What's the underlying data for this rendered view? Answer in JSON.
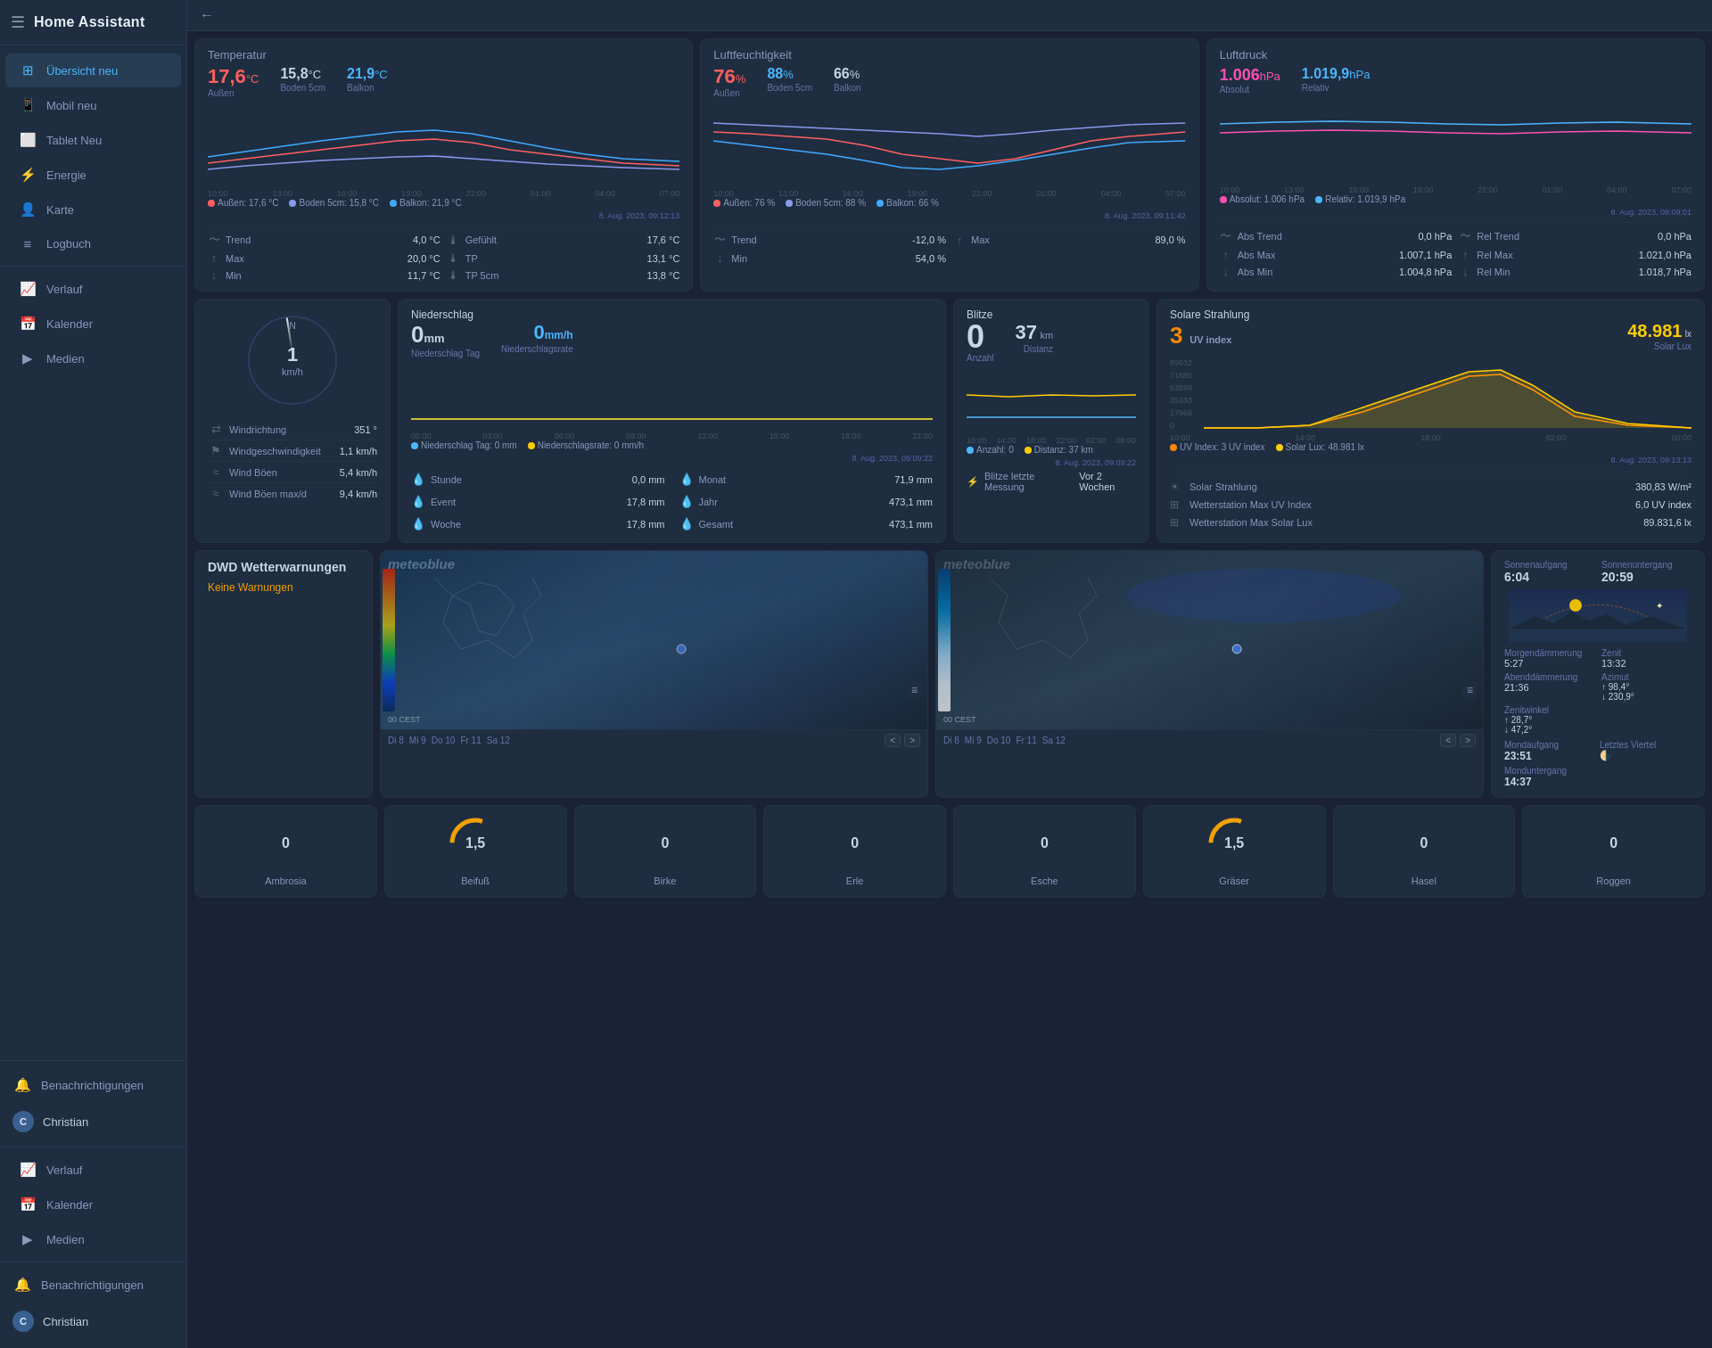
{
  "app": {
    "title": "Home Assistant",
    "back_label": "←"
  },
  "sidebar": {
    "items": [
      {
        "id": "ubersicht",
        "label": "Übersicht neu",
        "icon": "⊞",
        "active": true
      },
      {
        "id": "mobil",
        "label": "Mobil neu",
        "icon": "📱",
        "active": false
      },
      {
        "id": "tablet",
        "label": "Tablet Neu",
        "icon": "⬜",
        "active": false
      },
      {
        "id": "energie",
        "label": "Energie",
        "icon": "⚡",
        "active": false
      },
      {
        "id": "karte",
        "label": "Karte",
        "icon": "👤",
        "active": false
      },
      {
        "id": "logbuch",
        "label": "Logbuch",
        "icon": "≡",
        "active": false
      },
      {
        "id": "verlauf",
        "label": "Verlauf",
        "icon": "📈",
        "active": false
      },
      {
        "id": "kalender",
        "label": "Kalender",
        "icon": "📅",
        "active": false
      },
      {
        "id": "medien",
        "label": "Medien",
        "icon": "▶",
        "active": false
      }
    ],
    "bottom_items": [
      {
        "id": "benachrichtigungen",
        "label": "Benachrichtigungen",
        "icon": "🔔"
      },
      {
        "id": "verlauf2",
        "label": "Verlauf",
        "icon": "📈"
      },
      {
        "id": "kalender2",
        "label": "Kalender",
        "icon": "📅"
      },
      {
        "id": "medien2",
        "label": "Medien",
        "icon": "▶"
      }
    ],
    "user": {
      "name": "Christian",
      "initial": "C"
    },
    "notifications_label": "Benachrichtigungen"
  },
  "temp": {
    "title": "Temperatur",
    "aussen_val": "17,6",
    "aussen_unit": "°C",
    "aussen_label": "Außen",
    "boden_val": "15,8",
    "boden_unit": "°C",
    "boden_label": "Boden 5cm",
    "balkon_val": "21,9",
    "balkon_unit": "°C",
    "balkon_label": "Balkon",
    "timestamp": "8. Aug. 2023, 09:12:13",
    "legend_aussen": "Außen: 17,6 °C",
    "legend_boden": "Boden 5cm: 15,8 °C",
    "legend_balkon": "Balkon: 21,9 °C",
    "trend_label": "Trend",
    "trend_val": "4,0 °C",
    "max_label": "Max",
    "max_val": "20,0 °C",
    "min_label": "Min",
    "min_val": "11,7 °C",
    "gefuhlt_label": "Gefühlt",
    "gefuhlt_val": "17,6 °C",
    "tp_label": "TP",
    "tp_val": "13,1 °C",
    "tp5_label": "TP 5cm",
    "tp5_val": "13,8 °C"
  },
  "humidity": {
    "title": "Luftfeuchtigkeit",
    "aussen_val": "76",
    "aussen_unit": "%",
    "aussen_label": "Außen",
    "boden_val": "88",
    "boden_unit": "%",
    "boden_label": "Boden 5cm",
    "balkon_val": "66",
    "balkon_unit": "%",
    "balkon_label": "Balkon",
    "timestamp": "8. Aug. 2023, 09:11:42",
    "legend_aussen": "Außen: 76 %",
    "legend_boden": "Boden 5cm: 88 %",
    "legend_balkon": "Balkon: 66 %",
    "trend_label": "Trend",
    "trend_val": "-12,0 %",
    "max_label": "Max",
    "max_val": "89,0 %",
    "min_label": "Min",
    "min_val": "54,0 %"
  },
  "pressure": {
    "title": "Luftdruck",
    "abs_val": "1.006",
    "abs_unit": "hPa",
    "abs_label": "Absolut",
    "rel_val": "1.019,9",
    "rel_unit": "hPa",
    "rel_label": "Relativ",
    "timestamp": "8. Aug. 2023, 09:09:01",
    "legend_abs": "Absolut: 1.006 hPa",
    "legend_rel": "Relativ: 1.019,9 hPa",
    "abs_trend_label": "Abs Trend",
    "abs_trend_val": "0,0 hPa",
    "rel_trend_label": "Rel Trend",
    "rel_trend_val": "0,0 hPa",
    "abs_max_label": "Abs Max",
    "abs_max_val": "1.007,1 hPa",
    "rel_max_label": "Rel Max",
    "rel_max_val": "1.021,0 hPa",
    "abs_min_label": "Abs Min",
    "abs_min_val": "1.004,8 hPa",
    "rel_min_label": "Rel Min",
    "rel_min_val": "1.018,7 hPa"
  },
  "wind": {
    "speed": "1",
    "speed_unit": "km/h",
    "direction_label": "Windrichtung",
    "direction_val": "351 °",
    "speed_label": "Windgeschwindigkeit",
    "speed_val": "1,1 km/h",
    "boen_label": "Wind Böen",
    "boen_val": "5,4 km/h",
    "boen_max_label": "Wind Böen max/d",
    "boen_max_val": "9,4 km/h",
    "n_label": "N"
  },
  "niederschlag": {
    "title": "Niederschlag",
    "main_val": "0",
    "main_unit": "mm",
    "main_label": "Niederschlag Tag",
    "rate_val": "0",
    "rate_unit": "mm/h",
    "rate_label": "Niederschlagsrate",
    "timestamp": "8. Aug. 2023, 09:09:22",
    "legend_tag": "Niederschlag Tag: 0 mm",
    "legend_rate": "Niederschlagsrate: 0 mm/h",
    "stunde_label": "Stunde",
    "stunde_val": "0,0 mm",
    "monat_label": "Monat",
    "monat_val": "71,9 mm",
    "event_label": "Event",
    "event_val": "17,8 mm",
    "jahr_label": "Jahr",
    "jahr_val": "473,1 mm",
    "woche_label": "Woche",
    "woche_val": "17,8 mm",
    "gesamt_label": "Gesamt",
    "gesamt_val": "473,1 mm"
  },
  "blitze": {
    "title": "Blitze",
    "count_val": "0",
    "count_label": "Anzahl",
    "dist_val": "37",
    "dist_unit": "km",
    "dist_label": "Distanz",
    "last_label": "Blitze letzte Messung",
    "last_val": "Vor 2 Wochen",
    "timestamp": "8. Aug. 2023, 09:09:22",
    "legend_anzahl": "Anzahl: 0",
    "legend_distanz": "Distanz: 37 km"
  },
  "solar": {
    "title": "Solare Strahlung",
    "uv_index_val": "3",
    "uv_index_label": "UV index",
    "lux_val": "48.981",
    "lux_unit": "lx",
    "lux_label": "Solar Lux",
    "timestamp": "8. Aug. 2023, 09:13:13",
    "legend_uv": "UV Index: 3 UV index",
    "legend_lux": "Solar Lux: 48.981 lx",
    "solar_label": "Solar Strahlung",
    "solar_val": "380,83 W/m²",
    "uv_max_label": "Wetterstation Max UV Index",
    "uv_max_val": "6,0 UV index",
    "lux_max_label": "Wetterstation Max Solar Lux",
    "lux_max_val": "89.831,6 lx",
    "y_labels": [
      "89832",
      "71885",
      "53899",
      "35933",
      "17966",
      "0"
    ]
  },
  "wetter": {
    "title": "DWD Wetterwarnungen",
    "status": "Keine Warnungen"
  },
  "sun": {
    "sunrise_label": "Sonnenaufgang",
    "sunrise_val": "6:04",
    "sunset_label": "Sonnenuntergang",
    "sunset_val": "20:59",
    "dawn_label": "Morgendämmerung",
    "dawn_val": "5:27",
    "zenith_label": "Zenit",
    "zenith_val": "13:32",
    "dusk_label": "Abenddämmerung",
    "dusk_val": "21:36",
    "azimuth_label": "Azimut",
    "azimuth_val": "↑ 98,4°",
    "azimuth_val2": "↓ 230,9°",
    "zenith_angle_label": "Zenitwinkel",
    "zenith_angle_val": "↑ 28,7°",
    "zenith_angle_val2": "↓ 47,2°",
    "moonrise_label": "Mondaufgang",
    "moonrise_val": "23:51",
    "moon_phase_label": "Letztes Viertel",
    "moonset_label": "Monduntergang",
    "moonset_val": "14:37"
  },
  "pollen": [
    {
      "name": "Ambrosia",
      "val": "0",
      "ring_color": "#2a4060",
      "filled": 0
    },
    {
      "name": "Beifuß",
      "val": "1,5",
      "ring_color": "#f0a000",
      "filled": 0.3
    },
    {
      "name": "Birke",
      "val": "0",
      "ring_color": "#2a4060",
      "filled": 0
    },
    {
      "name": "Erle",
      "val": "0",
      "ring_color": "#2a4060",
      "filled": 0
    },
    {
      "name": "Esche",
      "val": "0",
      "ring_color": "#2a4060",
      "filled": 0
    },
    {
      "name": "Gräser",
      "val": "1,5",
      "ring_color": "#f0a000",
      "filled": 0.3
    },
    {
      "name": "Hasel",
      "val": "0",
      "ring_color": "#2a4060",
      "filled": 0
    },
    {
      "name": "Roggen",
      "val": "0",
      "ring_color": "#2a4060",
      "filled": 0
    }
  ],
  "maps": {
    "map1_brand": "meteoblue",
    "map1_dates": [
      "Di 8",
      "Mi 9",
      "Do 10",
      "Fr 11",
      "Sa 12"
    ],
    "map2_brand": "meteoblue",
    "map2_dates": [
      "Di 8",
      "Mi 9",
      "Do 10",
      "Fr 11",
      "Sa 12"
    ],
    "menu_icon": "≡"
  }
}
